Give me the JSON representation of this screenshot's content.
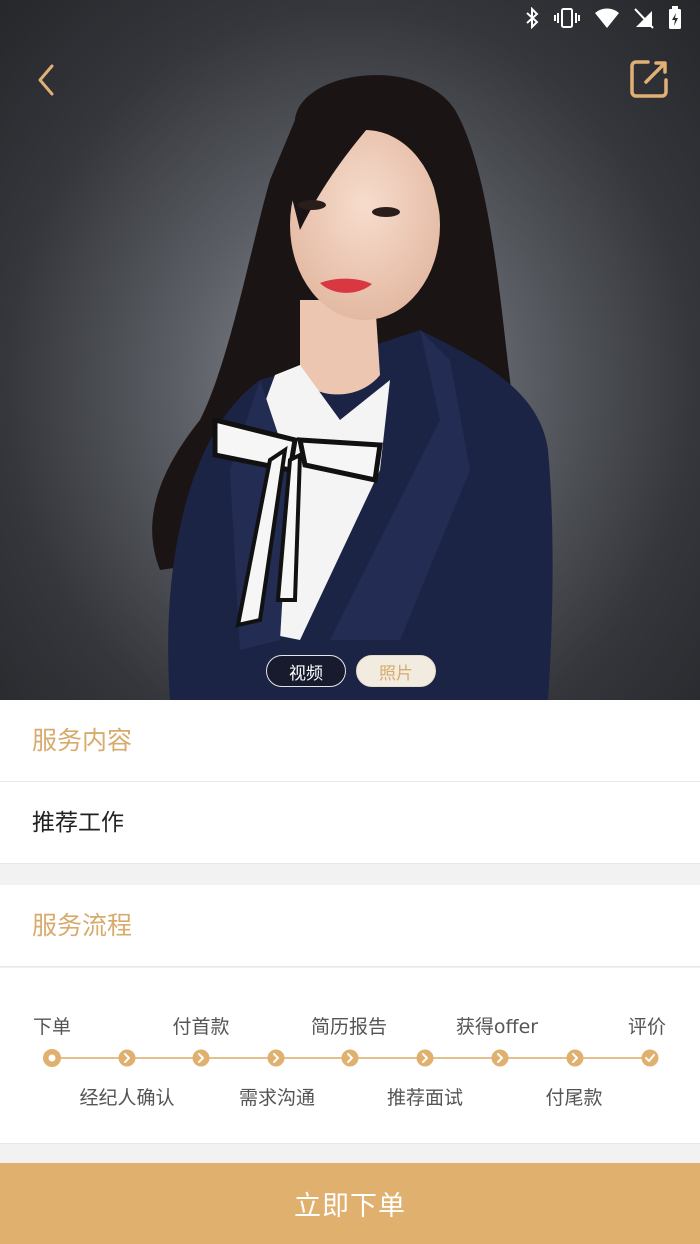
{
  "hero": {
    "toggle_video": "视频",
    "toggle_photo": "照片",
    "selected": "照片"
  },
  "service_content": {
    "title": "服务内容",
    "item": "推荐工作"
  },
  "service_flow": {
    "title": "服务流程",
    "steps_top": [
      "下单",
      "付首款",
      "简历报告",
      "获得offer",
      "评价"
    ],
    "steps_bottom": [
      "经纪人确认",
      "需求沟通",
      "推荐面试",
      "付尾款"
    ]
  },
  "footer": {
    "order_button": "立即下单"
  },
  "colors": {
    "accent": "#dfb06e",
    "accent_text": "#d8ab6d"
  },
  "icons": [
    "bluetooth-icon",
    "vibrate-icon",
    "wifi-icon",
    "no-sim-icon",
    "battery-charging-icon",
    "back-arrow-icon",
    "edit-icon"
  ]
}
